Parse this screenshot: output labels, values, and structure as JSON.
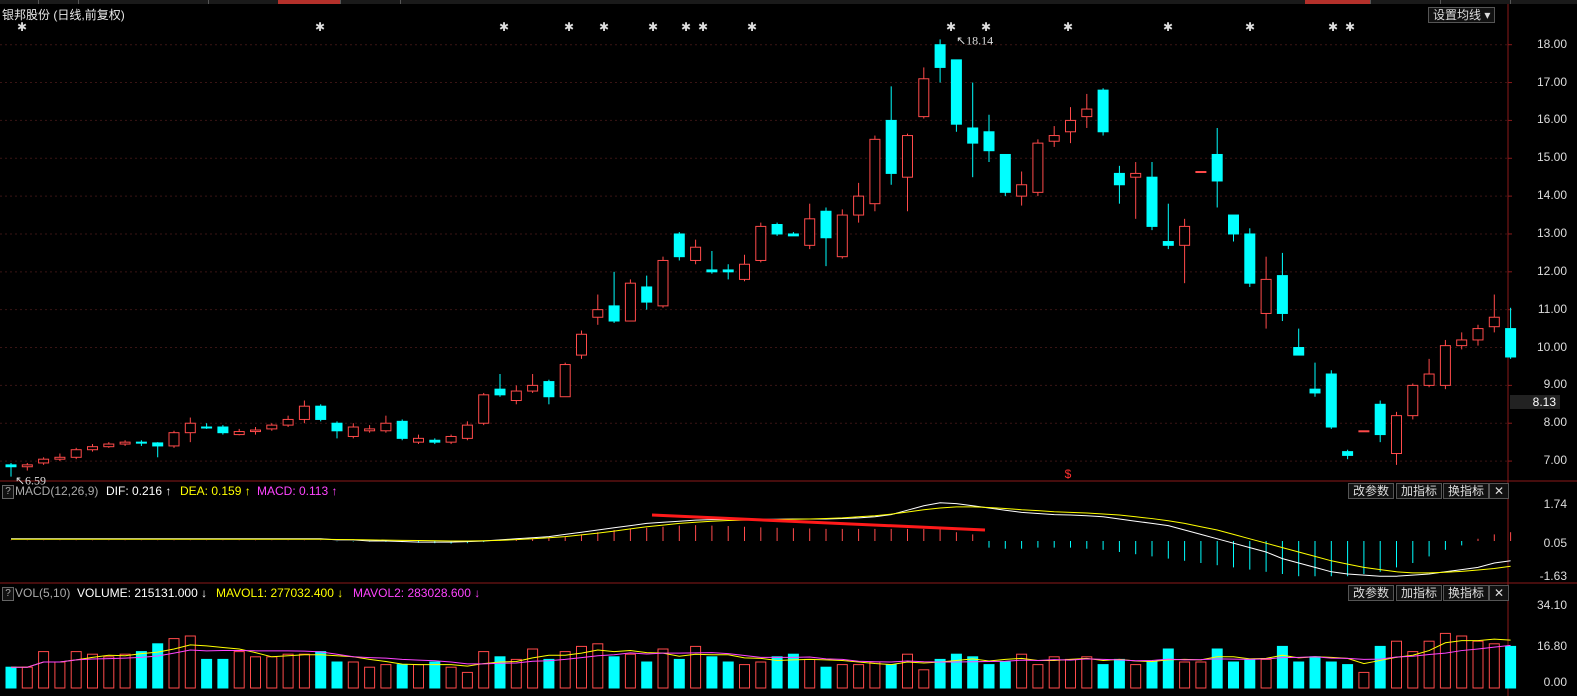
{
  "title": {
    "name": "银邦股份",
    "mode": "(日线,前复权)"
  },
  "ma_button": "设置均线 ▾",
  "price_axis": [
    "18.00",
    "17.00",
    "16.00",
    "15.00",
    "14.00",
    "13.00",
    "12.00",
    "11.00",
    "10.00",
    "9.00",
    "8.00",
    "7.00"
  ],
  "current_price": "8.13",
  "high_label": "18.14",
  "low_label": "6.59",
  "event_marker": "$",
  "macd": {
    "name": "MACD(12,26,9)",
    "dif": "DIF: 0.216 ↑",
    "dea": "DEA: 0.159 ↑",
    "macd": "MACD: 0.113 ↑",
    "axis": [
      "1.74",
      "0.05",
      "-1.63"
    ],
    "buttons": [
      "改参数",
      "加指标",
      "换指标",
      "✕"
    ]
  },
  "vol": {
    "name": "VOL(5,10)",
    "volume": "VOLUME: 215131.000 ↓",
    "mavol1": "MAVOL1: 277032.400 ↓",
    "mavol2": "MAVOL2: 283028.600 ↓",
    "axis": [
      "34.10",
      "16.80",
      "0.00"
    ],
    "buttons": [
      "改参数",
      "加指标",
      "换指标",
      "✕"
    ]
  },
  "help_mark": "?",
  "colors": {
    "up": "#ff4a4a",
    "down": "#00ffff",
    "dif": "#ffffff",
    "dea": "#ffff00",
    "macd_label": "#ff44ff",
    "bg": "#000000",
    "grid": "#3a1414"
  },
  "chart_data": {
    "type": "candlestick",
    "ylim": [
      6.5,
      18.6
    ],
    "candles": [
      [
        6.9,
        6.85,
        6.95,
        6.59
      ],
      [
        6.85,
        6.9,
        6.95,
        6.75
      ],
      [
        6.95,
        7.05,
        7.1,
        6.9
      ],
      [
        7.05,
        7.1,
        7.2,
        7.0
      ],
      [
        7.1,
        7.3,
        7.35,
        7.05
      ],
      [
        7.3,
        7.38,
        7.45,
        7.25
      ],
      [
        7.38,
        7.45,
        7.5,
        7.35
      ],
      [
        7.45,
        7.5,
        7.55,
        7.4
      ],
      [
        7.5,
        7.48,
        7.55,
        7.4
      ],
      [
        7.48,
        7.4,
        7.5,
        7.1
      ],
      [
        7.4,
        7.75,
        7.8,
        7.35
      ],
      [
        7.75,
        8.0,
        8.15,
        7.5
      ],
      [
        7.9,
        7.88,
        8.0,
        7.85
      ],
      [
        7.9,
        7.75,
        7.95,
        7.7
      ],
      [
        7.7,
        7.78,
        7.85,
        7.68
      ],
      [
        7.78,
        7.82,
        7.9,
        7.7
      ],
      [
        7.85,
        7.95,
        8.0,
        7.8
      ],
      [
        7.95,
        8.1,
        8.2,
        7.9
      ],
      [
        8.1,
        8.45,
        8.6,
        8.0
      ],
      [
        8.45,
        8.1,
        8.5,
        8.05
      ],
      [
        8.0,
        7.8,
        8.05,
        7.6
      ],
      [
        7.65,
        7.9,
        8.0,
        7.6
      ],
      [
        7.8,
        7.85,
        7.95,
        7.75
      ],
      [
        7.8,
        8.0,
        8.2,
        7.75
      ],
      [
        8.05,
        7.6,
        8.1,
        7.55
      ],
      [
        7.5,
        7.6,
        7.7,
        7.45
      ],
      [
        7.55,
        7.5,
        7.6,
        7.45
      ],
      [
        7.5,
        7.65,
        7.7,
        7.45
      ],
      [
        7.6,
        7.95,
        8.05,
        7.55
      ],
      [
        8.0,
        8.75,
        8.8,
        7.95
      ],
      [
        8.9,
        8.75,
        9.3,
        8.7
      ],
      [
        8.6,
        8.85,
        9.0,
        8.5
      ],
      [
        8.85,
        9.0,
        9.3,
        8.8
      ],
      [
        9.1,
        8.7,
        9.15,
        8.5
      ],
      [
        8.7,
        9.55,
        9.6,
        8.7
      ],
      [
        9.8,
        10.35,
        10.45,
        9.7
      ],
      [
        10.8,
        11.0,
        11.4,
        10.6
      ],
      [
        11.1,
        10.7,
        12.0,
        10.65
      ],
      [
        10.7,
        11.7,
        11.8,
        10.7
      ],
      [
        11.6,
        11.2,
        11.9,
        11.0
      ],
      [
        11.1,
        12.3,
        12.4,
        11.05
      ],
      [
        13.0,
        12.4,
        13.05,
        12.3
      ],
      [
        12.3,
        12.65,
        12.85,
        12.2
      ],
      [
        12.05,
        12.0,
        12.55,
        11.95
      ],
      [
        12.05,
        12.0,
        12.2,
        11.8
      ],
      [
        11.8,
        12.2,
        12.45,
        11.75
      ],
      [
        12.3,
        13.2,
        13.3,
        12.25
      ],
      [
        13.25,
        13.0,
        13.3,
        12.95
      ],
      [
        13.0,
        12.95,
        13.05,
        12.95
      ],
      [
        12.7,
        13.4,
        13.8,
        12.6
      ],
      [
        13.6,
        12.9,
        13.7,
        12.15
      ],
      [
        12.4,
        13.5,
        13.65,
        12.35
      ],
      [
        13.5,
        14.0,
        14.35,
        13.3
      ],
      [
        13.8,
        15.5,
        15.6,
        13.6
      ],
      [
        16.0,
        14.6,
        16.9,
        14.3
      ],
      [
        14.5,
        15.6,
        15.65,
        13.6
      ],
      [
        16.1,
        17.1,
        17.4,
        16.05
      ],
      [
        18.0,
        17.4,
        18.14,
        17.0
      ],
      [
        17.6,
        15.9,
        17.55,
        15.7
      ],
      [
        15.8,
        15.4,
        17.0,
        14.5
      ],
      [
        15.7,
        15.2,
        16.15,
        14.9
      ],
      [
        15.1,
        14.1,
        15.1,
        14.0
      ],
      [
        14.0,
        14.3,
        14.65,
        13.75
      ],
      [
        14.1,
        15.4,
        15.5,
        14.0
      ],
      [
        15.45,
        15.6,
        15.85,
        15.3
      ],
      [
        15.7,
        16.0,
        16.35,
        15.4
      ],
      [
        16.1,
        16.3,
        16.7,
        15.8
      ],
      [
        16.8,
        15.7,
        16.85,
        15.6
      ],
      [
        14.6,
        14.3,
        14.8,
        13.8
      ],
      [
        14.5,
        14.6,
        14.9,
        13.4
      ],
      [
        14.5,
        13.2,
        14.9,
        13.1
      ],
      [
        12.8,
        12.7,
        13.8,
        12.6
      ],
      [
        12.7,
        13.2,
        13.4,
        11.7
      ],
      [
        14.65,
        14.65,
        14.65,
        14.65
      ],
      [
        15.1,
        14.4,
        15.8,
        13.7
      ],
      [
        13.5,
        13.0,
        13.5,
        12.8
      ],
      [
        13.0,
        11.7,
        13.15,
        11.6
      ],
      [
        10.9,
        11.8,
        12.4,
        10.5
      ],
      [
        11.9,
        10.9,
        12.5,
        10.7
      ],
      [
        10.0,
        9.8,
        10.5,
        9.8
      ],
      [
        8.9,
        8.8,
        9.6,
        8.7
      ],
      [
        9.3,
        7.9,
        9.4,
        7.85
      ],
      [
        7.25,
        7.15,
        7.3,
        7.05
      ],
      [
        7.8,
        7.8,
        7.8,
        7.8
      ],
      [
        8.5,
        7.7,
        8.6,
        7.5
      ],
      [
        7.2,
        8.2,
        8.3,
        6.9
      ],
      [
        8.2,
        9.0,
        9.05,
        8.1
      ],
      [
        9.0,
        9.3,
        9.7,
        8.95
      ],
      [
        9.0,
        10.05,
        10.2,
        8.9
      ],
      [
        10.05,
        10.2,
        10.4,
        9.95
      ],
      [
        10.2,
        10.5,
        10.6,
        10.05
      ],
      [
        10.55,
        10.8,
        11.4,
        10.4
      ],
      [
        10.5,
        9.75,
        11.05,
        9.7
      ]
    ],
    "macd_hist": [
      0.01,
      0.01,
      0.01,
      0.01,
      0.01,
      0.01,
      0.01,
      0.01,
      0.01,
      0.01,
      0.01,
      0.01,
      0.01,
      0.01,
      0.01,
      0.01,
      0.01,
      0.01,
      0.01,
      0.01,
      -0.01,
      -0.02,
      -0.03,
      -0.04,
      -0.05,
      -0.08,
      -0.1,
      -0.12,
      -0.1,
      -0.05,
      0.01,
      0.05,
      0.1,
      0.15,
      0.2,
      0.3,
      0.4,
      0.5,
      0.55,
      0.6,
      0.65,
      0.7,
      0.72,
      0.7,
      0.68,
      0.65,
      0.62,
      0.6,
      0.58,
      0.57,
      0.55,
      0.55,
      0.55,
      0.55,
      0.55,
      0.55,
      0.55,
      0.55,
      0.4,
      0.3,
      -0.3,
      -0.35,
      -0.35,
      -0.3,
      -0.3,
      -0.3,
      -0.35,
      -0.4,
      -0.5,
      -0.6,
      -0.7,
      -0.8,
      -0.9,
      -1.0,
      -1.1,
      -1.2,
      -1.3,
      -1.4,
      -1.5,
      -1.6,
      -1.6,
      -1.6,
      -1.6,
      -1.5,
      -1.4,
      -1.2,
      -1.0,
      -0.7,
      -0.4,
      -0.2,
      0.1,
      0.3,
      0.4
    ],
    "dif": [
      0.1,
      0.1,
      0.1,
      0.1,
      0.1,
      0.1,
      0.1,
      0.1,
      0.1,
      0.1,
      0.1,
      0.1,
      0.1,
      0.1,
      0.1,
      0.1,
      0.1,
      0.1,
      0.1,
      0.1,
      0.05,
      0.05,
      0.0,
      0.0,
      -0.02,
      -0.05,
      -0.05,
      -0.05,
      -0.03,
      0.0,
      0.05,
      0.1,
      0.15,
      0.2,
      0.3,
      0.4,
      0.5,
      0.6,
      0.7,
      0.8,
      0.85,
      0.9,
      0.95,
      0.97,
      0.98,
      0.98,
      0.98,
      0.99,
      1.0,
      1.0,
      1.0,
      1.02,
      1.05,
      1.1,
      1.2,
      1.4,
      1.6,
      1.74,
      1.7,
      1.6,
      1.5,
      1.4,
      1.3,
      1.25,
      1.2,
      1.18,
      1.15,
      1.1,
      1.0,
      0.9,
      0.8,
      0.7,
      0.5,
      0.3,
      0.1,
      -0.1,
      -0.3,
      -0.5,
      -0.8,
      -1.0,
      -1.2,
      -1.4,
      -1.5,
      -1.55,
      -1.6,
      -1.6,
      -1.55,
      -1.5,
      -1.4,
      -1.3,
      -1.2,
      -1.0,
      -0.9
    ],
    "dea": [
      0.08,
      0.08,
      0.08,
      0.08,
      0.08,
      0.08,
      0.08,
      0.08,
      0.08,
      0.08,
      0.08,
      0.08,
      0.08,
      0.08,
      0.08,
      0.08,
      0.08,
      0.08,
      0.08,
      0.08,
      0.07,
      0.06,
      0.05,
      0.04,
      0.03,
      0.02,
      0.01,
      0.0,
      0.0,
      0.01,
      0.03,
      0.06,
      0.1,
      0.15,
      0.2,
      0.28,
      0.36,
      0.45,
      0.55,
      0.65,
      0.72,
      0.8,
      0.85,
      0.9,
      0.93,
      0.95,
      0.97,
      0.98,
      0.99,
      1.0,
      1.02,
      1.05,
      1.1,
      1.15,
      1.22,
      1.32,
      1.42,
      1.5,
      1.55,
      1.55,
      1.52,
      1.48,
      1.42,
      1.38,
      1.33,
      1.3,
      1.27,
      1.23,
      1.18,
      1.1,
      1.02,
      0.92,
      0.8,
      0.65,
      0.5,
      0.3,
      0.1,
      -0.1,
      -0.3,
      -0.5,
      -0.7,
      -0.9,
      -1.05,
      -1.2,
      -1.3,
      -1.4,
      -1.45,
      -1.45,
      -1.42,
      -1.38,
      -1.32,
      -1.25,
      -1.15
    ],
    "volume": [
      8,
      8,
      14,
      10,
      14,
      13,
      12,
      13,
      14,
      17,
      19,
      20,
      11,
      11,
      14,
      12,
      12,
      13,
      13,
      14,
      10,
      10,
      8,
      9,
      9,
      9,
      10,
      8,
      6,
      14,
      12,
      11,
      15,
      11,
      14,
      16,
      17,
      12,
      13,
      10,
      15,
      11,
      16,
      12,
      10,
      9,
      10,
      12,
      13,
      11,
      8,
      9,
      9,
      10,
      9,
      13,
      7,
      11,
      13,
      12,
      9,
      10,
      13,
      9,
      12,
      11,
      12,
      9,
      11,
      9,
      10,
      15,
      10,
      10,
      15,
      10,
      11,
      11,
      16,
      10,
      12,
      10,
      9,
      6,
      16,
      18,
      14,
      18,
      21,
      20,
      18,
      17,
      16
    ]
  }
}
